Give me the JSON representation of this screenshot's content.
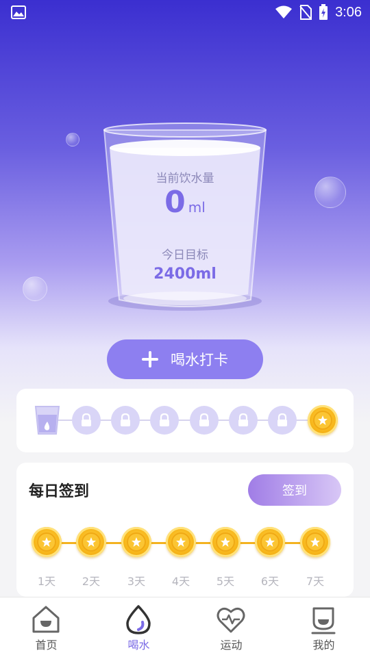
{
  "status_bar": {
    "time": "3:06",
    "icons": [
      "image-icon",
      "wifi-icon",
      "no-sim-icon",
      "battery-charging-icon"
    ]
  },
  "glass": {
    "current_label": "当前饮水量",
    "current_value": "0",
    "current_unit": "ml",
    "goal_label": "今日目标",
    "goal_value": "2400ml"
  },
  "checkin_button": {
    "label": "喝水打卡",
    "icon": "plus-icon"
  },
  "progress": {
    "steps": [
      {
        "state": "current",
        "icon": "cup-icon"
      },
      {
        "state": "locked",
        "icon": "lock-icon"
      },
      {
        "state": "locked",
        "icon": "lock-icon"
      },
      {
        "state": "locked",
        "icon": "lock-icon"
      },
      {
        "state": "locked",
        "icon": "lock-icon"
      },
      {
        "state": "locked",
        "icon": "lock-icon"
      },
      {
        "state": "locked",
        "icon": "lock-icon"
      },
      {
        "state": "reward",
        "icon": "star-coin-icon"
      }
    ]
  },
  "daily_sign": {
    "title": "每日签到",
    "button_label": "签到",
    "days": [
      "1天",
      "2天",
      "3天",
      "4天",
      "5天",
      "6天",
      "7天"
    ]
  },
  "tabbar": {
    "tabs": [
      {
        "label": "首页",
        "icon": "home-icon"
      },
      {
        "label": "喝水",
        "icon": "water-drop-icon",
        "active": true
      },
      {
        "label": "运动",
        "icon": "heart-pulse-icon"
      },
      {
        "label": "我的",
        "icon": "profile-icon"
      }
    ]
  },
  "colors": {
    "accent": "#7b6be6",
    "button": "#8d7ff0",
    "coin": "#f7b61a",
    "hero_top": "#3b2fd0"
  }
}
